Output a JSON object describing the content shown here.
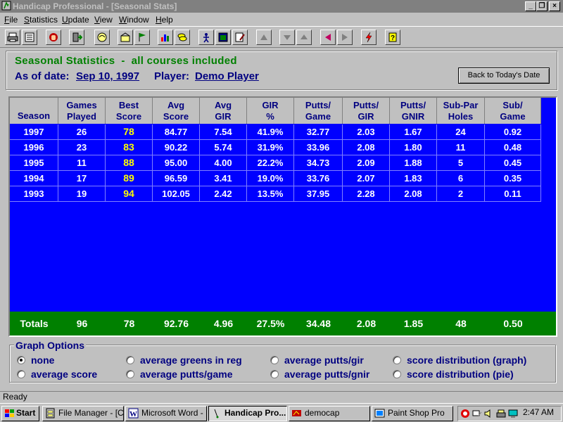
{
  "window": {
    "title": "Handicap Professional - [Seasonal Stats]",
    "controls": [
      "_",
      "❐",
      "×"
    ]
  },
  "menu": [
    {
      "label": "File",
      "u": "F",
      "rest": "ile"
    },
    {
      "label": "Statistics",
      "u": "S",
      "rest": "tatistics"
    },
    {
      "label": "Update",
      "u": "U",
      "rest": "pdate"
    },
    {
      "label": "View",
      "u": "V",
      "rest": "iew"
    },
    {
      "label": "Window",
      "u": "W",
      "rest": "indow"
    },
    {
      "label": "Help",
      "u": "H",
      "rest": "elp"
    }
  ],
  "toolbar": {
    "icons": [
      "print-icon",
      "scorecard-icon",
      "stop-hand-icon",
      "enter-round-icon",
      "golfer-icon",
      "course-icon",
      "flag-icon",
      "bar-chart-icon",
      "coins-icon",
      "player-icon",
      "window-icon",
      "edit-icon",
      "disabled-tool-icon",
      "down-arrow-icon",
      "up-arrow-icon",
      "back-arrow-icon",
      "forward-arrow-icon",
      "lightning-icon",
      "help-icon"
    ]
  },
  "header": {
    "title": "Seasonal Statistics  -  all courses included",
    "as_of_label": "As of date:",
    "as_of_value": "Sep 10, 1997",
    "player_label": "Player:",
    "player_value": "Demo Player",
    "back_button": "Back to Today's Date"
  },
  "table": {
    "columns": [
      [
        "Season"
      ],
      [
        "Games",
        "Played"
      ],
      [
        "Best",
        "Score"
      ],
      [
        "Avg",
        "Score"
      ],
      [
        "Avg",
        "GIR"
      ],
      [
        "GIR",
        "%"
      ],
      [
        "Putts/",
        "Game"
      ],
      [
        "Putts/",
        "GIR"
      ],
      [
        "Putts/",
        "GNIR"
      ],
      [
        "Sub-Par",
        "Holes"
      ],
      [
        "Sub/",
        "Game"
      ]
    ],
    "rows": [
      [
        "1997",
        "26",
        "78",
        "84.77",
        "7.54",
        "41.9%",
        "32.77",
        "2.03",
        "1.67",
        "24",
        "0.92"
      ],
      [
        "1996",
        "23",
        "83",
        "90.22",
        "5.74",
        "31.9%",
        "33.96",
        "2.08",
        "1.80",
        "11",
        "0.48"
      ],
      [
        "1995",
        "11",
        "88",
        "95.00",
        "4.00",
        "22.2%",
        "34.73",
        "2.09",
        "1.88",
        "5",
        "0.45"
      ],
      [
        "1994",
        "17",
        "89",
        "96.59",
        "3.41",
        "19.0%",
        "33.76",
        "2.07",
        "1.83",
        "6",
        "0.35"
      ],
      [
        "1993",
        "19",
        "94",
        "102.05",
        "2.42",
        "13.5%",
        "37.95",
        "2.28",
        "2.08",
        "2",
        "0.11"
      ]
    ],
    "totals": [
      "Totals",
      "96",
      "78",
      "92.76",
      "4.96",
      "27.5%",
      "34.48",
      "2.08",
      "1.85",
      "48",
      "0.50"
    ]
  },
  "graph_options": {
    "title": "Graph Options",
    "selected": "none",
    "options": [
      "none",
      "average score",
      "average greens in reg",
      "average putts/game",
      "average putts/gir",
      "average putts/gnir",
      "score distribution (graph)",
      "score distribution (pie)"
    ]
  },
  "status": "Ready",
  "taskbar": {
    "start": "Start",
    "tasks": [
      "File Manager - [C...",
      "Microsoft Word - ...",
      "Handicap Pro...",
      "democap",
      "Paint Shop Pro"
    ],
    "active": "Handicap Pro...",
    "clock": "2:47 AM"
  },
  "colors": {
    "table_bg": "#0000ff",
    "header_text": "#000080",
    "title_green": "#008000",
    "best_score": "#ffff00",
    "totals_bg": "#008000"
  }
}
